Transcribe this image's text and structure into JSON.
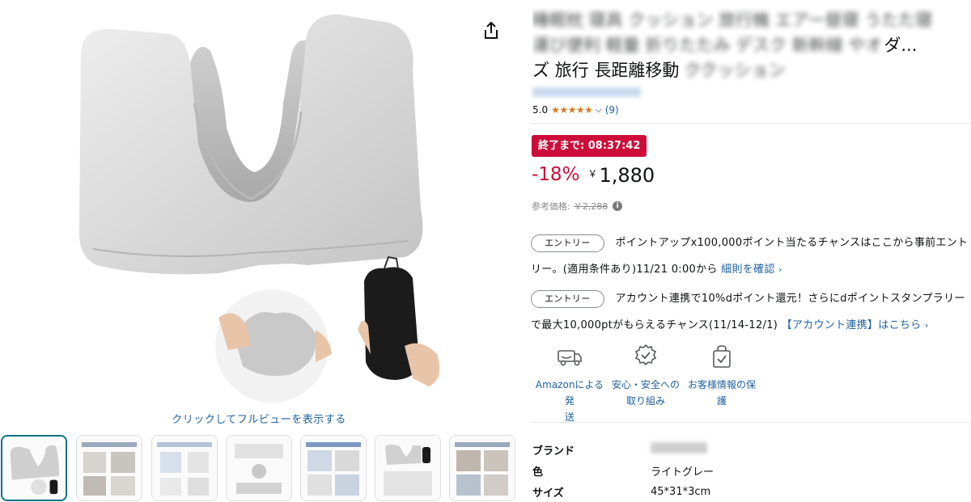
{
  "product": {
    "title_lines": [
      {
        "text": "睡眠枕 寝具 クッション 旅行機 エアー昼寝 うたた寝",
        "tail": ""
      },
      {
        "text": "運び便利 軽量 折りたたみ デスク 新幹線 やオ",
        "tail": "ダ..."
      },
      {
        "text": "ズ 旅行 長距離移動 ",
        "tail": ""
      }
    ],
    "title_line3_visible": "ズ 旅行 長距離移動",
    "rating_value": "5.0",
    "stars": "★★★★★",
    "review_count": "(9)"
  },
  "deal": {
    "badge": "終了まで: 08:37:42",
    "discount": "-18%",
    "currency": "￥",
    "price": "1,880",
    "ref_label": "参考価格:",
    "ref_price": "￥2,288",
    "info_icon": "i"
  },
  "promos": [
    {
      "pill": "エントリー",
      "text": "ポイントアップx100,000ポイント当たるチャンスはここから事前エントリー。(適用条件あり)11/21 0:00から",
      "link": "細則を確認",
      "caret": "›"
    },
    {
      "pill": "エントリー",
      "text": "アカウント連携で10%dポイント還元！さらにdポイントスタンプラリーで最大10,000ptがもらえるチャンス(11/14-12/1)",
      "link": "【アカウント連携】はこちら",
      "caret": "›"
    }
  ],
  "features": [
    {
      "icon": "delivery-truck-icon",
      "label_1": "Amazonによる発",
      "label_2": "送"
    },
    {
      "icon": "safety-badge-icon",
      "label_1": "安心・安全への",
      "label_2": "取り組み"
    },
    {
      "icon": "secure-bag-icon",
      "label_1": "お客様情報の保",
      "label_2": "護"
    }
  ],
  "specs": [
    {
      "key": "ブランド",
      "value": ""
    },
    {
      "key": "色",
      "value": "ライトグレー"
    },
    {
      "key": "サイズ",
      "value": "45*31*3cm"
    }
  ],
  "gallery": {
    "fullview_link": "クリックしてフルビューを表示する",
    "thumbnail_count": 7,
    "selected_index": 0
  },
  "colors": {
    "deal_red": "#cc0c39",
    "link_blue": "#2162a1",
    "star_orange": "#de7921",
    "selected_thumb": "#007185"
  }
}
